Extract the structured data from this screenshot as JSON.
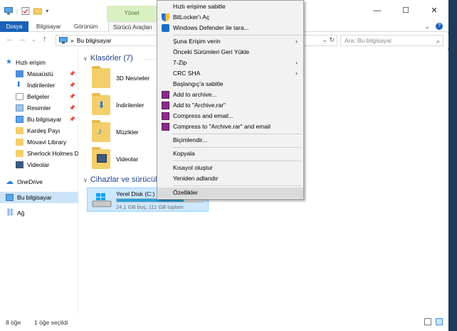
{
  "window": {
    "context_tab": "Yönet",
    "controls": [
      "—",
      "☐",
      "✕"
    ]
  },
  "ribbon": {
    "tabs": [
      "Dosya",
      "Bilgisayar",
      "Görünüm",
      "Sürücü Araçları"
    ]
  },
  "address": {
    "path_root": "»",
    "path": "Bu bilgisayar",
    "search_placeholder": "Ara: Bu bilgisayar"
  },
  "nav": {
    "quick_access": "Hızlı erişim",
    "pinned": [
      {
        "label": "Masaüstü",
        "icon": "desktop-icon"
      },
      {
        "label": "İndirilenler",
        "icon": "downloads-icon"
      },
      {
        "label": "Belgeler",
        "icon": "documents-icon"
      },
      {
        "label": "Resimler",
        "icon": "pictures-icon"
      },
      {
        "label": "Bu bilgisayar",
        "icon": "computer-icon"
      }
    ],
    "recent": [
      "Kardeş Payı",
      "Movavi Library",
      "Sherlock Holmes Di",
      "Videolar"
    ],
    "onedrive": "OneDrive",
    "this_pc": "Bu bilgisayar",
    "network": "Ağ"
  },
  "content": {
    "folders_header": "Klasörler (7)",
    "folders": [
      "3D Nesneler",
      "İndirilenler",
      "Müzikler",
      "Videolar"
    ],
    "devices_header": "Cihazlar ve sürücüler",
    "drive": {
      "name": "Yerel Disk (C:)",
      "info": "24,1 GB boş, 111 GB toplam",
      "used_fraction": 0.78
    }
  },
  "status": {
    "count": "8 öğe",
    "selected": "1 öğe seçildi"
  },
  "context_menu": {
    "items": [
      {
        "label": "Hızlı erişime sabitle"
      },
      {
        "label": "BitLocker'ı Aç",
        "icon": "shield-icon"
      },
      {
        "label": "Windows Defender ile tara...",
        "icon": "defender-icon"
      },
      {
        "label": "Şuna Erişim verin",
        "submenu": true
      },
      {
        "label": "Önceki Sürümleri Geri Yükle"
      },
      {
        "label": "7-Zip",
        "submenu": true
      },
      {
        "label": "CRC SHA",
        "submenu": true
      },
      {
        "label": "Başlangıç'a sabitle"
      },
      {
        "label": "Add to archive...",
        "icon": "winrar-icon"
      },
      {
        "label": "Add to \"Archive.rar\"",
        "icon": "winrar-icon"
      },
      {
        "label": "Compress and email...",
        "icon": "winrar-icon"
      },
      {
        "label": "Compress to \"Archive.rar\" and email",
        "icon": "winrar-icon"
      },
      {
        "label": "Biçimlendir..."
      },
      {
        "label": "Kopyala"
      },
      {
        "label": "Kısayol oluştur"
      },
      {
        "label": "Yeniden adlandır"
      },
      {
        "label": "Özellikler",
        "highlighted": true
      }
    ]
  }
}
